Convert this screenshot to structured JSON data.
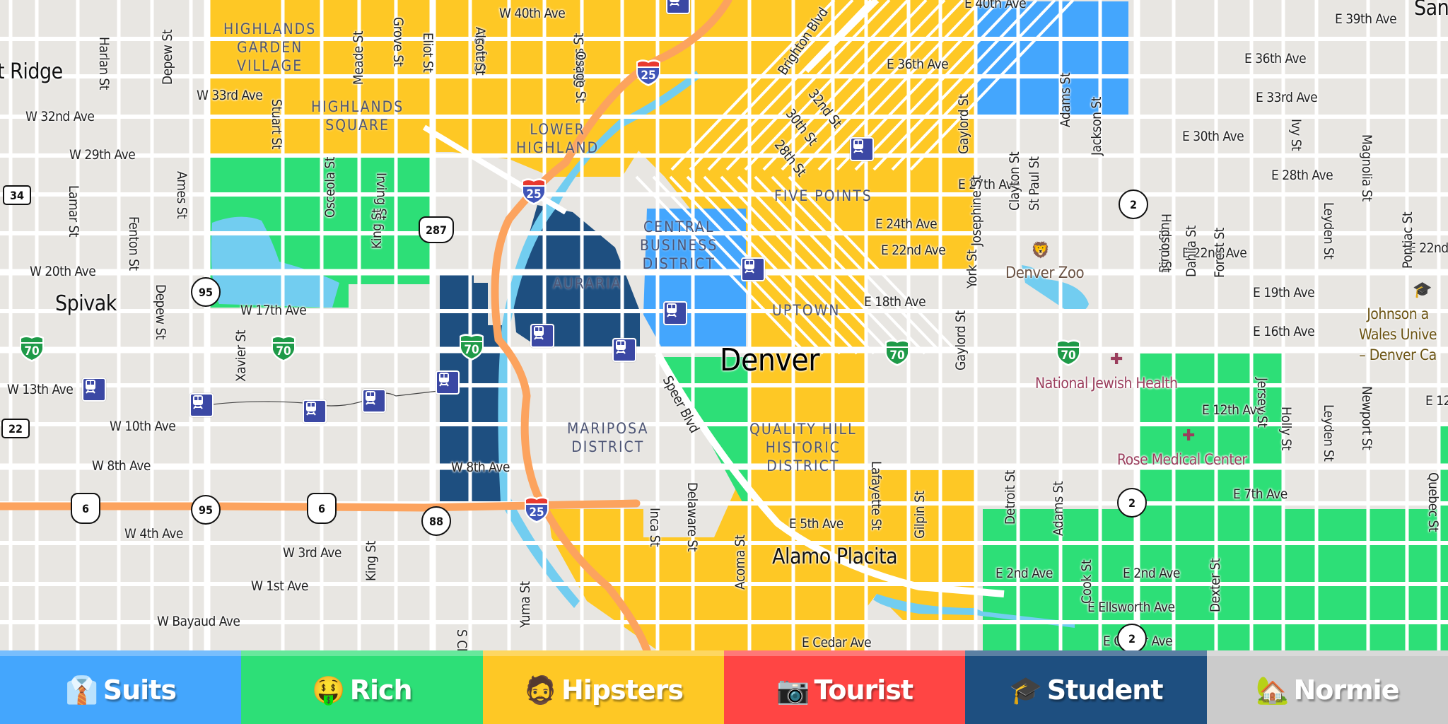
{
  "map": {
    "colors": {
      "suits": "#44a6fd",
      "rich": "#2ddf77",
      "hipsters": "#fec825",
      "tourist": "#ff4544",
      "student": "#1e4f80",
      "normie": "#cbcbcb",
      "water": "#72cdf0",
      "background": "#e8e6e2",
      "road": "#ffffff",
      "highway": "#fca35e"
    },
    "cities": {
      "wheat_ridge": "t Ridge",
      "spivak": "Spivak",
      "denver": "Denver",
      "alamo_placita": "Alamo Placita",
      "sand_creek": "San"
    },
    "neighborhoods": {
      "highlands_garden_village": "HIGHLANDS\nGARDEN\nVILLAGE",
      "highlands_square": "HIGHLANDS\nSQUARE",
      "lower_highland": "LOWER\nHIGHLAND",
      "five_points": "FIVE POINTS",
      "central_business_district": "CENTRAL\nBUSINESS\nDISTRICT",
      "auraria": "AURARIA",
      "uptown": "UPTOWN",
      "mariposa_district": "MARIPOSA\nDISTRICT",
      "quality_hill": "QUALITY HILL\nHISTORIC\nDISTRICT"
    },
    "streets_h": {
      "w40": "W 40th Ave",
      "w33": "W 33rd Ave",
      "w32": "W 32nd Ave",
      "w29": "W 29th Ave",
      "w20": "W 20th Ave",
      "w17": "W 17th Ave",
      "w13": "W 13th Ave",
      "w10": "W 10th Ave",
      "w8a": "W 8th Ave",
      "w8b": "W 8th Ave",
      "w4": "W 4th Ave",
      "w3": "W 3rd Ave",
      "w1": "W 1st Ave",
      "wbayaud": "W Bayaud Ave",
      "e40": "E 40th Ave",
      "e39": "E 39th Ave",
      "e36a": "E 36th Ave",
      "e36b": "E 36th Ave",
      "e33": "E 33rd Ave",
      "e30": "E 30th Ave",
      "e28": "E 28th Ave",
      "e27": "E 27th Ave",
      "e24": "E 24th Ave",
      "e22a": "E 22nd Ave",
      "e22b": "E 22nd Ave",
      "e22c": "E 22nd Ave",
      "e19": "E 19th Ave",
      "e18": "E 18th Ave",
      "e16": "E 16th Ave",
      "e12a": "E 12th Ave",
      "e12b": "E 12t",
      "e7": "E 7th Ave",
      "e5": "E 5th Ave",
      "e2a": "E 2nd Ave",
      "e2b": "E 2nd Ave",
      "ellsworth": "E Ellsworth Ave",
      "ecedar_a": "E Cedar Ave",
      "ecedar_b": "E Cedar Ave"
    },
    "streets_v": {
      "harlan": "Harlan St",
      "depew1": "Depew St",
      "meade": "Meade St",
      "grove": "Grove St",
      "eliot": "Eliot St",
      "clay": "Clay St",
      "alcott": "Alcott St",
      "quivas": "Quivas St",
      "osage": "Osage St",
      "stuart": "Stuart St",
      "osceola": "Osceola St",
      "irving": "Irving St",
      "king1": "King St",
      "ames": "Ames St",
      "lamar": "Lamar St",
      "fenton": "Fenton St",
      "depew2": "Depew St",
      "xavier": "Xavier St",
      "king2": "King St",
      "yuma": "Yuma St",
      "sclay": "S Cl",
      "inca": "Inca St",
      "delaware": "Delaware St",
      "acoma": "Acoma St",
      "lafayette": "Lafayette St",
      "gilpin": "Gilpin St",
      "speer": "Speer Blvd",
      "brighton": "Brighton Blvd",
      "s32": "32nd St",
      "s30": "30th St",
      "s28": "28th St",
      "gaylord1": "Gaylord St",
      "gaylord2": "Gaylord St",
      "josephine": "Josephine St",
      "clayton": "Clayton St",
      "stpaul": "St Paul St",
      "adams1": "Adams St",
      "jackson": "Jackson St",
      "york": "York St",
      "birch": "Birch St",
      "dahlia": "Dahlia St",
      "forest": "Forest St",
      "hudson": "Hudson St",
      "ivy": "Ivy St",
      "leyden1": "Leyden St",
      "magnolia": "Magnolia St",
      "pontiac": "Pontiac St",
      "detroit": "Detroit St",
      "adams2": "Adams St",
      "holly": "Holly St",
      "jersey": "Jersey St",
      "leyden2": "Leyden St",
      "newport": "Newport St",
      "quebec": "Quebec St",
      "cook": "Cook St",
      "dexter": "Dexter St",
      "sjersey": "S Jersey St"
    },
    "pois": {
      "zoo": "Denver Zoo",
      "national_jewish": "National Jewish Health",
      "rose": "Rose Medical Center",
      "johnson_wales": "Johnson a\nWales Unive\n– Denver Ca"
    },
    "shields": {
      "sr34": "34",
      "sr22": "22",
      "sr95a": "95",
      "sr95b": "95",
      "sr88": "88",
      "sr2a": "2",
      "sr2b": "2",
      "sr2c": "2",
      "us287": "287",
      "us6a": "6",
      "us6b": "6",
      "i25a": "25",
      "i25b": "25",
      "i25c": "25",
      "i70a": "70",
      "i70b": "70",
      "i70c": "70",
      "i70d": "70",
      "i70e": "70"
    }
  },
  "legend": [
    {
      "key": "suits",
      "emoji": "👔",
      "label": "Suits",
      "color": "#44a6fd"
    },
    {
      "key": "rich",
      "emoji": "🤑",
      "label": "Rich",
      "color": "#2ddf77"
    },
    {
      "key": "hipsters",
      "emoji": "🧔",
      "label": "Hipsters",
      "color": "#fec825"
    },
    {
      "key": "tourist",
      "emoji": "📷",
      "label": "Tourist",
      "color": "#ff4544"
    },
    {
      "key": "student",
      "emoji": "🎓",
      "label": "Student",
      "color": "#1e4f80"
    },
    {
      "key": "normie",
      "emoji": "🏡",
      "label": "Normie",
      "color": "#cbcbcb"
    }
  ]
}
